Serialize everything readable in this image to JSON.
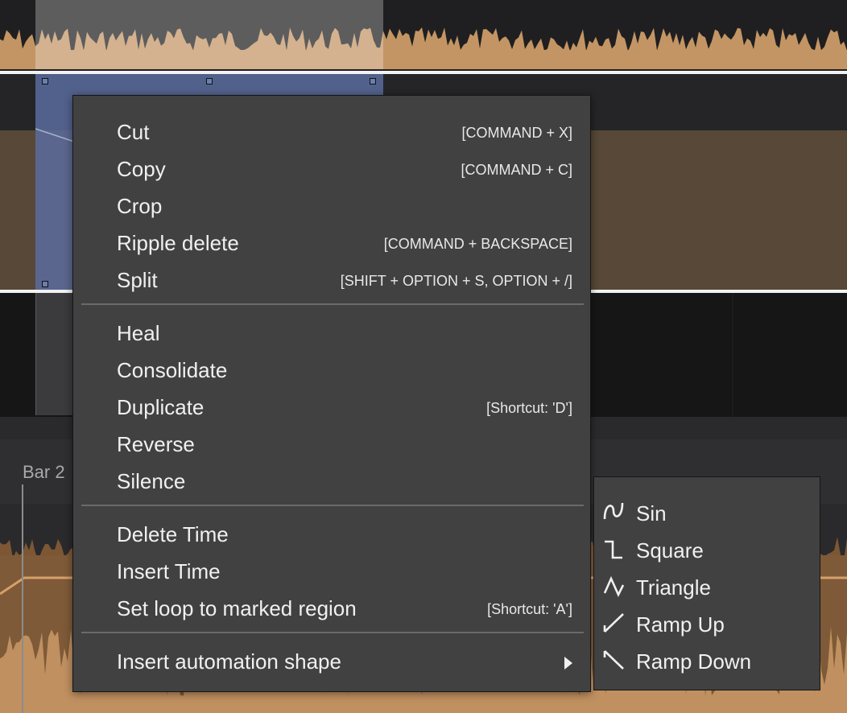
{
  "timeline": {
    "ruler_label": "Bar 2"
  },
  "context_menu": {
    "groups": [
      [
        {
          "label": "Cut",
          "shortcut": "[COMMAND + X]"
        },
        {
          "label": "Copy",
          "shortcut": "[COMMAND + C]"
        },
        {
          "label": "Crop",
          "shortcut": ""
        },
        {
          "label": "Ripple delete",
          "shortcut": "[COMMAND + BACKSPACE]"
        },
        {
          "label": "Split",
          "shortcut": "[SHIFT + OPTION + S, OPTION + /]"
        }
      ],
      [
        {
          "label": "Heal",
          "shortcut": ""
        },
        {
          "label": "Consolidate",
          "shortcut": ""
        },
        {
          "label": "Duplicate",
          "shortcut": "[Shortcut: 'D']"
        },
        {
          "label": "Reverse",
          "shortcut": ""
        },
        {
          "label": "Silence",
          "shortcut": ""
        }
      ],
      [
        {
          "label": "Delete Time",
          "shortcut": ""
        },
        {
          "label": "Insert Time",
          "shortcut": ""
        },
        {
          "label": "Set loop to marked region",
          "shortcut": "[Shortcut: 'A']"
        }
      ],
      [
        {
          "label": "Insert automation shape",
          "shortcut": "",
          "submenu": true
        }
      ]
    ]
  },
  "automation_submenu": {
    "items": [
      {
        "label": "Sin",
        "icon": "sine-wave-icon"
      },
      {
        "label": "Square",
        "icon": "square-wave-icon"
      },
      {
        "label": "Triangle",
        "icon": "triangle-wave-icon"
      },
      {
        "label": "Ramp Up",
        "icon": "ramp-up-icon"
      },
      {
        "label": "Ramp Down",
        "icon": "ramp-down-icon"
      }
    ]
  },
  "colors": {
    "menu_bg": "#414141",
    "selection_blue": "#5a6c9d",
    "waveform": "#c8a075",
    "automation_band": "#574837"
  }
}
